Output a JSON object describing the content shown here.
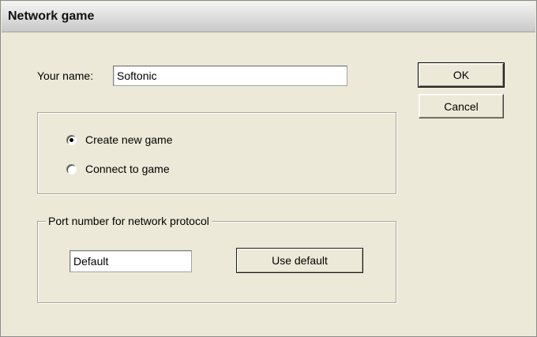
{
  "window": {
    "title": "Network game"
  },
  "name_field": {
    "label": "Your name:",
    "value": "Softonic"
  },
  "buttons": {
    "ok": "OK",
    "cancel": "Cancel"
  },
  "game_mode": {
    "options": [
      {
        "label": "Create new game",
        "selected": true
      },
      {
        "label": "Connect to game",
        "selected": false
      }
    ]
  },
  "port": {
    "group_label": "Port number for network protocol",
    "value": "Default",
    "use_default_label": "Use default"
  }
}
